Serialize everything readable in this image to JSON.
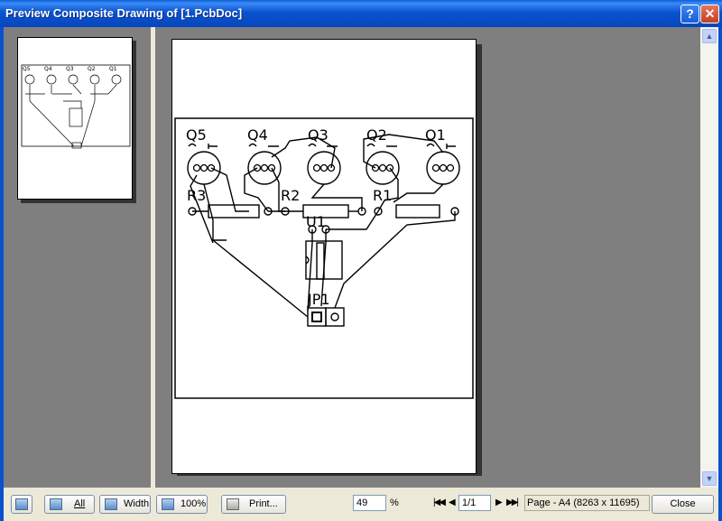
{
  "window": {
    "title": "Preview Composite Drawing of [1.PcbDoc]",
    "help_glyph": "?",
    "close_glyph": "✕"
  },
  "pcb": {
    "transistors": [
      "Q5",
      "Q4",
      "Q3",
      "Q2",
      "Q1"
    ],
    "resistors": [
      "R3",
      "R2",
      "R1"
    ],
    "ic": "U1",
    "connector": "JP1"
  },
  "toolbar": {
    "all_label": "All",
    "width_label": "Width",
    "zoom100_label": "100%",
    "print_label": "Print...",
    "zoom_value": "49",
    "zoom_unit": "%",
    "page_value": "1/1",
    "page_info": "Page - A4 (8263 x 11695)",
    "close_label": "Close",
    "first_page_glyph": "|◀◀",
    "prev_page_glyph": "◀",
    "next_page_glyph": "▶",
    "last_page_glyph": "▶▶|"
  },
  "icons": {
    "thumbnail_toggle": "thumbnails-icon",
    "all": "fit-all-icon",
    "width": "fit-width-icon",
    "zoom100": "actual-size-icon",
    "print": "printer-icon"
  }
}
